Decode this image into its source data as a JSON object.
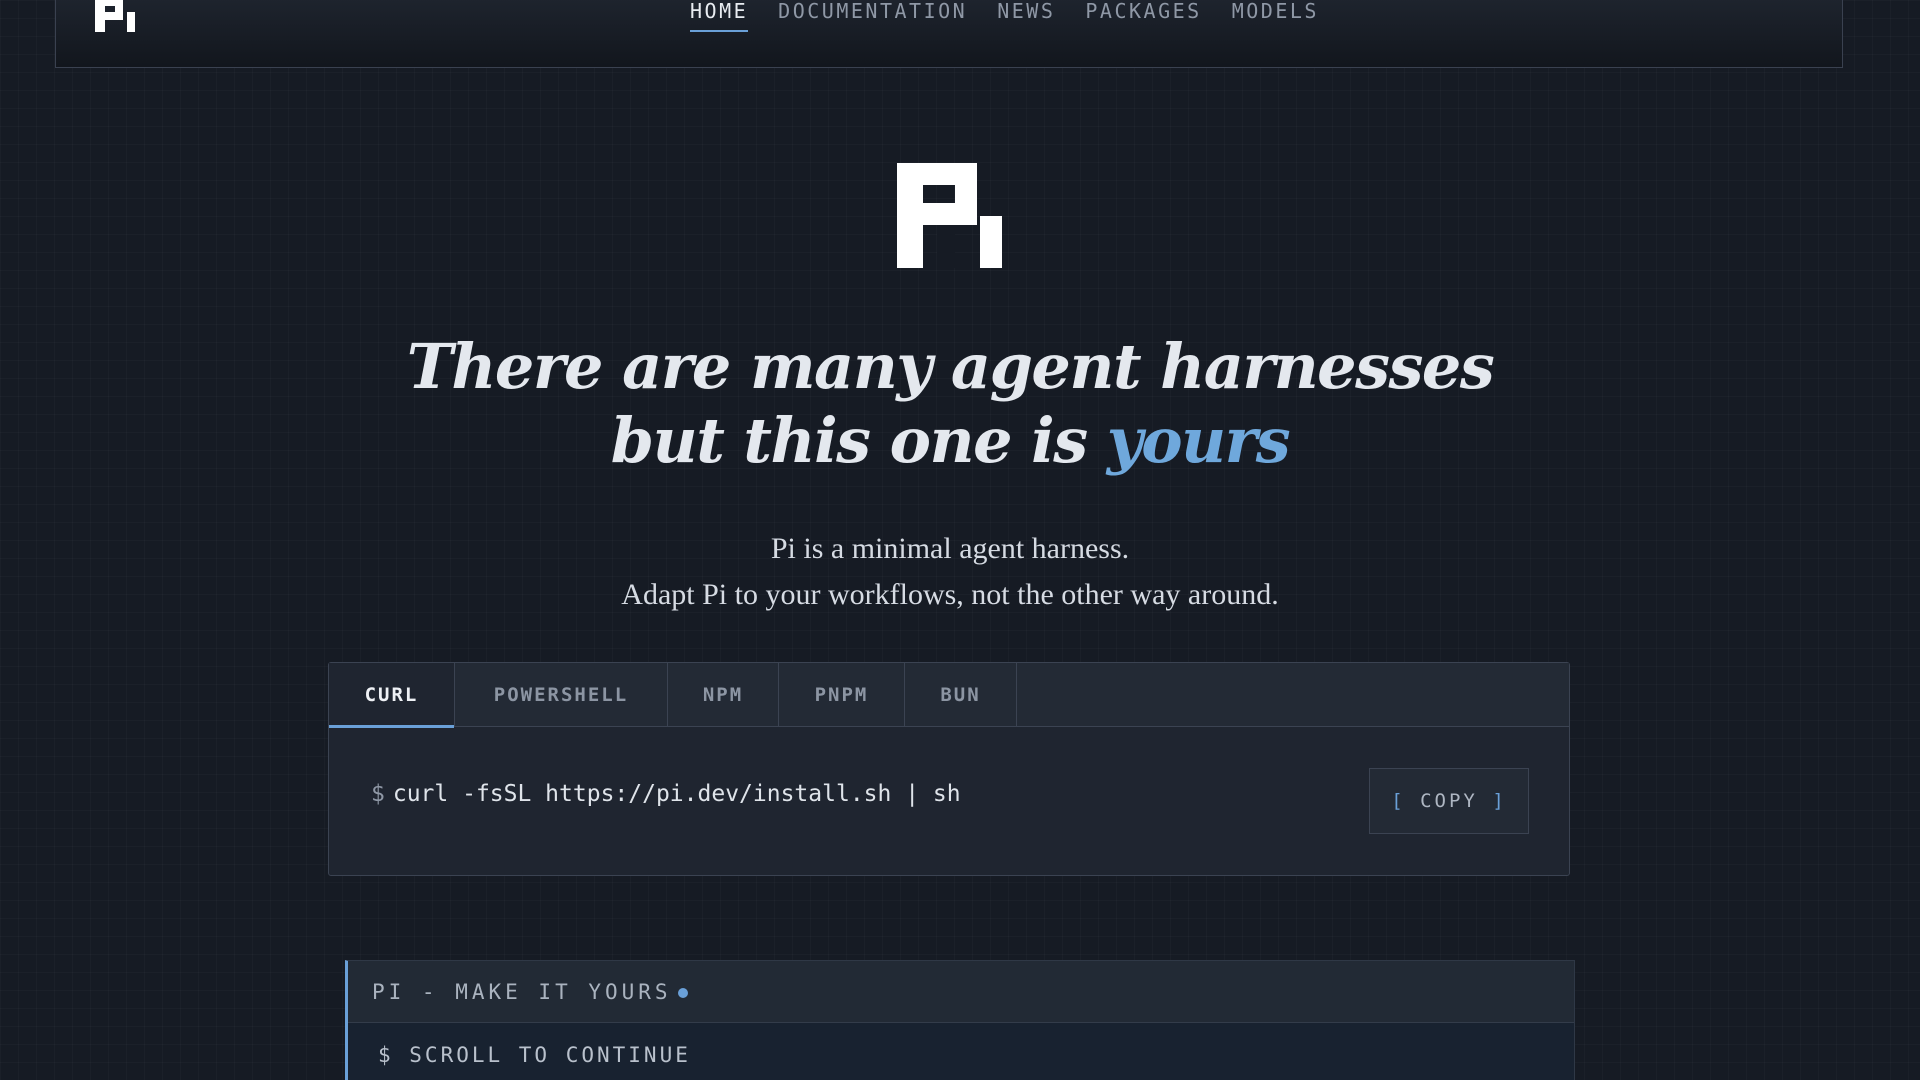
{
  "nav": {
    "logo": "pi-logo",
    "links": [
      {
        "label": "HOME",
        "active": true
      },
      {
        "label": "DOCUMENTATION",
        "active": false
      },
      {
        "label": "NEWS",
        "active": false
      },
      {
        "label": "PACKAGES",
        "active": false
      },
      {
        "label": "MODELS",
        "active": false
      }
    ]
  },
  "hero": {
    "logo": "pi-logo",
    "headline_line1": "There are many agent harnesses",
    "headline_line2_prefix": "but this one is ",
    "headline_line2_accent": "yours",
    "subtitle_line1": "Pi is a minimal agent harness.",
    "subtitle_line2": "Adapt Pi to your workflows, not the other way around."
  },
  "install": {
    "tabs": [
      {
        "label": "CURL",
        "active": true
      },
      {
        "label": "POWERSHELL",
        "active": false
      },
      {
        "label": "NPM",
        "active": false
      },
      {
        "label": "PNPM",
        "active": false
      },
      {
        "label": "BUN",
        "active": false
      }
    ],
    "prompt": "$",
    "command": "curl -fsSL https://pi.dev/install.sh | sh",
    "copy_open": "[",
    "copy_label": "COPY",
    "copy_close": "]"
  },
  "terminal": {
    "title": "PI - MAKE IT YOURS",
    "line": "$ SCROLL TO CONTINUE"
  },
  "colors": {
    "accent": "#6aa0d8",
    "background": "#161b24"
  }
}
